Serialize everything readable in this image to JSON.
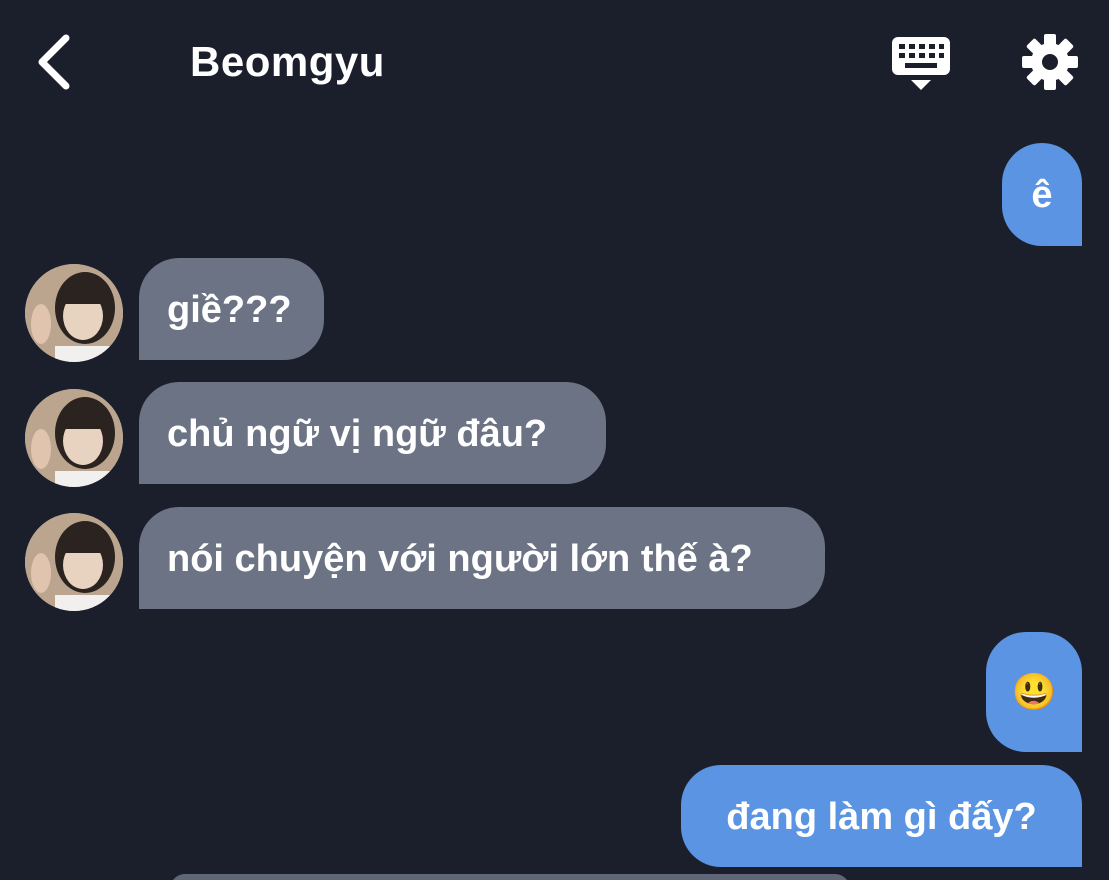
{
  "header": {
    "contact_name": "Beomgyu",
    "back_icon": "chevron-left-icon",
    "keyboard_icon": "keyboard-icon",
    "settings_icon": "gear-icon"
  },
  "colors": {
    "background": "#1b1e2b",
    "sent_bubble": "#5b94e3",
    "received_bubble": "#6b7384",
    "text": "#ffffff"
  },
  "messages": [
    {
      "from": "me",
      "text": "ê"
    },
    {
      "from": "Beomgyu",
      "text": "giề???"
    },
    {
      "from": "Beomgyu",
      "text": "chủ ngữ vị ngữ đâu?"
    },
    {
      "from": "Beomgyu",
      "text": "nói chuyện với người lớn thế à?"
    },
    {
      "from": "me",
      "text": "😃"
    },
    {
      "from": "me",
      "text": "đang làm gì đấy?"
    }
  ]
}
